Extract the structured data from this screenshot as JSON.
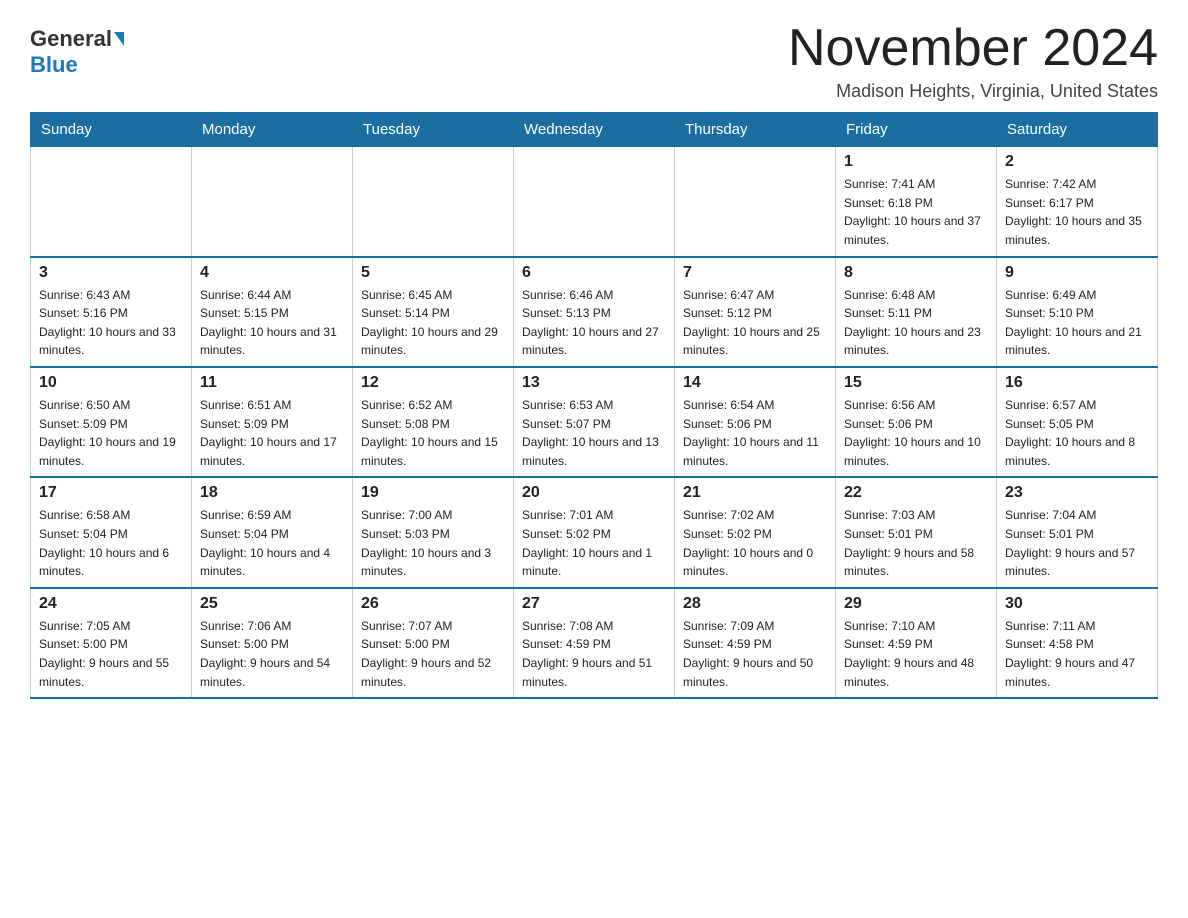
{
  "logo": {
    "general": "General",
    "blue": "Blue"
  },
  "header": {
    "title": "November 2024",
    "subtitle": "Madison Heights, Virginia, United States"
  },
  "weekdays": [
    "Sunday",
    "Monday",
    "Tuesday",
    "Wednesday",
    "Thursday",
    "Friday",
    "Saturday"
  ],
  "weeks": [
    [
      {
        "day": "",
        "info": ""
      },
      {
        "day": "",
        "info": ""
      },
      {
        "day": "",
        "info": ""
      },
      {
        "day": "",
        "info": ""
      },
      {
        "day": "",
        "info": ""
      },
      {
        "day": "1",
        "info": "Sunrise: 7:41 AM\nSunset: 6:18 PM\nDaylight: 10 hours and 37 minutes."
      },
      {
        "day": "2",
        "info": "Sunrise: 7:42 AM\nSunset: 6:17 PM\nDaylight: 10 hours and 35 minutes."
      }
    ],
    [
      {
        "day": "3",
        "info": "Sunrise: 6:43 AM\nSunset: 5:16 PM\nDaylight: 10 hours and 33 minutes."
      },
      {
        "day": "4",
        "info": "Sunrise: 6:44 AM\nSunset: 5:15 PM\nDaylight: 10 hours and 31 minutes."
      },
      {
        "day": "5",
        "info": "Sunrise: 6:45 AM\nSunset: 5:14 PM\nDaylight: 10 hours and 29 minutes."
      },
      {
        "day": "6",
        "info": "Sunrise: 6:46 AM\nSunset: 5:13 PM\nDaylight: 10 hours and 27 minutes."
      },
      {
        "day": "7",
        "info": "Sunrise: 6:47 AM\nSunset: 5:12 PM\nDaylight: 10 hours and 25 minutes."
      },
      {
        "day": "8",
        "info": "Sunrise: 6:48 AM\nSunset: 5:11 PM\nDaylight: 10 hours and 23 minutes."
      },
      {
        "day": "9",
        "info": "Sunrise: 6:49 AM\nSunset: 5:10 PM\nDaylight: 10 hours and 21 minutes."
      }
    ],
    [
      {
        "day": "10",
        "info": "Sunrise: 6:50 AM\nSunset: 5:09 PM\nDaylight: 10 hours and 19 minutes."
      },
      {
        "day": "11",
        "info": "Sunrise: 6:51 AM\nSunset: 5:09 PM\nDaylight: 10 hours and 17 minutes."
      },
      {
        "day": "12",
        "info": "Sunrise: 6:52 AM\nSunset: 5:08 PM\nDaylight: 10 hours and 15 minutes."
      },
      {
        "day": "13",
        "info": "Sunrise: 6:53 AM\nSunset: 5:07 PM\nDaylight: 10 hours and 13 minutes."
      },
      {
        "day": "14",
        "info": "Sunrise: 6:54 AM\nSunset: 5:06 PM\nDaylight: 10 hours and 11 minutes."
      },
      {
        "day": "15",
        "info": "Sunrise: 6:56 AM\nSunset: 5:06 PM\nDaylight: 10 hours and 10 minutes."
      },
      {
        "day": "16",
        "info": "Sunrise: 6:57 AM\nSunset: 5:05 PM\nDaylight: 10 hours and 8 minutes."
      }
    ],
    [
      {
        "day": "17",
        "info": "Sunrise: 6:58 AM\nSunset: 5:04 PM\nDaylight: 10 hours and 6 minutes."
      },
      {
        "day": "18",
        "info": "Sunrise: 6:59 AM\nSunset: 5:04 PM\nDaylight: 10 hours and 4 minutes."
      },
      {
        "day": "19",
        "info": "Sunrise: 7:00 AM\nSunset: 5:03 PM\nDaylight: 10 hours and 3 minutes."
      },
      {
        "day": "20",
        "info": "Sunrise: 7:01 AM\nSunset: 5:02 PM\nDaylight: 10 hours and 1 minute."
      },
      {
        "day": "21",
        "info": "Sunrise: 7:02 AM\nSunset: 5:02 PM\nDaylight: 10 hours and 0 minutes."
      },
      {
        "day": "22",
        "info": "Sunrise: 7:03 AM\nSunset: 5:01 PM\nDaylight: 9 hours and 58 minutes."
      },
      {
        "day": "23",
        "info": "Sunrise: 7:04 AM\nSunset: 5:01 PM\nDaylight: 9 hours and 57 minutes."
      }
    ],
    [
      {
        "day": "24",
        "info": "Sunrise: 7:05 AM\nSunset: 5:00 PM\nDaylight: 9 hours and 55 minutes."
      },
      {
        "day": "25",
        "info": "Sunrise: 7:06 AM\nSunset: 5:00 PM\nDaylight: 9 hours and 54 minutes."
      },
      {
        "day": "26",
        "info": "Sunrise: 7:07 AM\nSunset: 5:00 PM\nDaylight: 9 hours and 52 minutes."
      },
      {
        "day": "27",
        "info": "Sunrise: 7:08 AM\nSunset: 4:59 PM\nDaylight: 9 hours and 51 minutes."
      },
      {
        "day": "28",
        "info": "Sunrise: 7:09 AM\nSunset: 4:59 PM\nDaylight: 9 hours and 50 minutes."
      },
      {
        "day": "29",
        "info": "Sunrise: 7:10 AM\nSunset: 4:59 PM\nDaylight: 9 hours and 48 minutes."
      },
      {
        "day": "30",
        "info": "Sunrise: 7:11 AM\nSunset: 4:58 PM\nDaylight: 9 hours and 47 minutes."
      }
    ]
  ]
}
